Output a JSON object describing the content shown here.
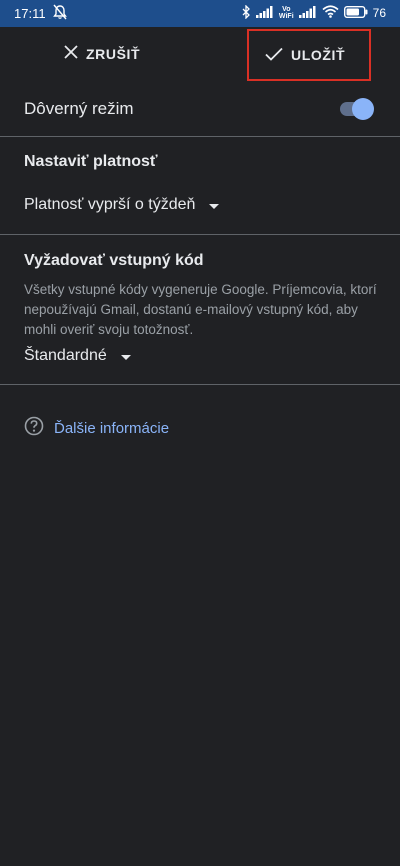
{
  "status_bar": {
    "time": "17:11",
    "volte_top": "Vo",
    "volte_bottom": "WiFi",
    "battery_percent": "76",
    "battery_level": 0.76
  },
  "toolbar": {
    "cancel_label": "ZRUŠIŤ",
    "save_label": "ULOŽIŤ"
  },
  "confidential_mode": {
    "label": "Dôverný režim",
    "enabled": true
  },
  "expiration": {
    "title": "Nastaviť platnosť",
    "selected": "Platnosť vyprší o týždeň"
  },
  "passcode": {
    "title": "Vyžadovať vstupný kód",
    "description": "Všetky vstupné kódy vygeneruje Google. Príjemcovia, ktorí nepoužívajú Gmail, dostanú e-mailový vstupný kód, aby mohli overiť svoju totožnosť.",
    "selected": "Štandardné"
  },
  "more_info": {
    "label": "Ďalšie informácie"
  },
  "colors": {
    "background": "#202124",
    "status_bar": "#1e4e8c",
    "accent": "#8ab4f8",
    "highlight_border": "#d93025"
  }
}
